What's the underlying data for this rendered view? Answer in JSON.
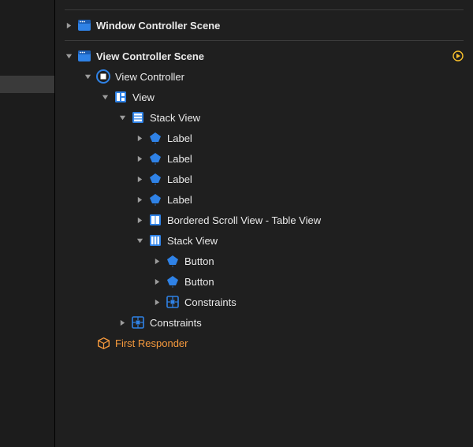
{
  "scenes": {
    "window_controller_scene": "Window Controller Scene",
    "view_controller_scene": "View Controller Scene"
  },
  "tree": {
    "view_controller": "View Controller",
    "view": "View",
    "stack_view": "Stack View",
    "label": "Label",
    "bordered_scroll": "Bordered Scroll View - Table View",
    "stack_view2": "Stack View",
    "button": "Button",
    "constraints": "Constraints",
    "first_responder": "First Responder"
  },
  "icons": {
    "scene": "window-scene-icon",
    "view_controller": "view-controller-icon",
    "view": "layout-icon",
    "stack_h": "stack-horizontal-icon",
    "stack_v": "stack-vertical-icon",
    "label": "label-icon",
    "scroll": "table-icon",
    "button": "button-icon",
    "constraints": "constraints-icon",
    "cube": "cube-icon"
  },
  "colors": {
    "accent_orange": "#f79a3d",
    "accent_blue": "#2f82e6",
    "accent_yellow": "#f7bf2b",
    "bg": "#1f1f1f",
    "text": "#eaeaea"
  }
}
